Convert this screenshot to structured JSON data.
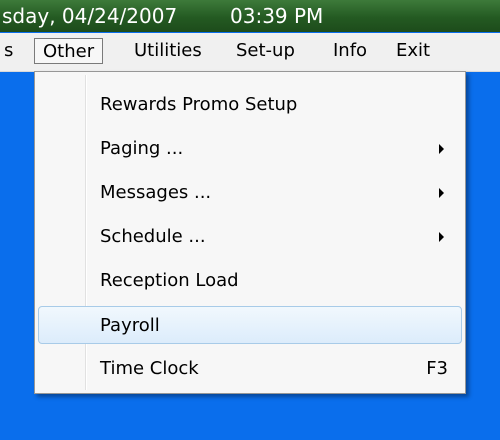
{
  "titlebar": {
    "date_text": "sday, 04/24/2007",
    "time_text": "03:39 PM"
  },
  "menubar": {
    "items": [
      {
        "label": "s"
      },
      {
        "label": "Other"
      },
      {
        "label": "Utilities"
      },
      {
        "label": "Set-up"
      },
      {
        "label": "Info"
      },
      {
        "label": "Exit"
      }
    ]
  },
  "dropdown": {
    "items": [
      {
        "label": "Rewards Promo Setup"
      },
      {
        "label": "Paging ...",
        "has_submenu": true
      },
      {
        "label": "Messages ...",
        "has_submenu": true
      },
      {
        "label": "Schedule ...",
        "has_submenu": true
      },
      {
        "label": "Reception Load"
      },
      {
        "label": "Payroll",
        "highlighted": true
      },
      {
        "label": "Time Clock",
        "shortcut": "F3"
      }
    ]
  },
  "colors": {
    "background": "#0a6eec",
    "titlebar": "#245a22",
    "menubar": "#f0f0f0",
    "highlight": "#dcecfb"
  }
}
